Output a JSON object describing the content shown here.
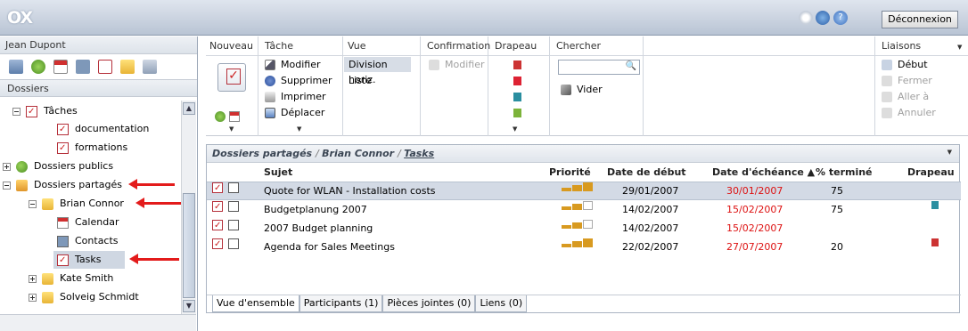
{
  "app": {
    "logo": "OX",
    "logout_label": "Déconnexion"
  },
  "left": {
    "user": "Jean Dupont",
    "section_label": "Dossiers",
    "tree": [
      {
        "label": "Tâches"
      },
      {
        "label": "documentation"
      },
      {
        "label": "formations"
      },
      {
        "label": "Dossiers publics"
      },
      {
        "label": "Dossiers partagés"
      },
      {
        "label": "Brian Connor"
      },
      {
        "label": "Calendar"
      },
      {
        "label": "Contacts"
      },
      {
        "label": "Tasks"
      },
      {
        "label": "Kate Smith"
      },
      {
        "label": "Solveig Schmidt"
      }
    ]
  },
  "toolbar": {
    "groups": {
      "nouveau": "Nouveau",
      "tache": "Tâche",
      "vue": "Vue",
      "confirmation": "Confirmation",
      "drapeau": "Drapeau",
      "chercher": "Chercher",
      "liaisons": "Liaisons"
    },
    "tache_items": [
      "Modifier",
      "Supprimer",
      "Imprimer",
      "Déplacer"
    ],
    "vue_items": [
      "Division horiz.",
      "Liste"
    ],
    "confirmation_item": "Modifier",
    "search_clear": "Vider",
    "search_value": "",
    "liaisons_items": [
      "Début",
      "Fermer",
      "Aller à",
      "Annuler"
    ]
  },
  "grid": {
    "breadcrumb": {
      "part1": "Dossiers partagés",
      "part2": "Brian Connor",
      "part3": "Tasks"
    },
    "columns": {
      "subject": "Sujet",
      "priority": "Priorité",
      "start": "Date de début",
      "due": "Date d'échéance ▲",
      "done": "% terminé",
      "flag": "Drapeau"
    },
    "rows": [
      {
        "subject": "Quote for WLAN - Installation costs",
        "priority": 3,
        "start": "29/01/2007",
        "due": "30/01/2007",
        "done": "75",
        "flag": ""
      },
      {
        "subject": "Budgetplanung 2007",
        "priority": 2,
        "start": "14/02/2007",
        "due": "15/02/2007",
        "done": "75",
        "flag": "teal"
      },
      {
        "subject": "2007 Budget planning",
        "priority": 2,
        "start": "14/02/2007",
        "due": "15/02/2007",
        "done": "",
        "flag": ""
      },
      {
        "subject": "Agenda for Sales Meetings",
        "priority": 3,
        "start": "22/02/2007",
        "due": "27/07/2007",
        "done": "20",
        "flag": "red"
      }
    ],
    "tabs": [
      "Vue d'ensemble",
      "Participants (1)",
      "Pièces jointes (0)",
      "Liens (0)"
    ]
  },
  "colors": {
    "due_overdue": "#dd1111",
    "selection": "#d3dae5",
    "annotation_arrow": "#e31b1b"
  }
}
